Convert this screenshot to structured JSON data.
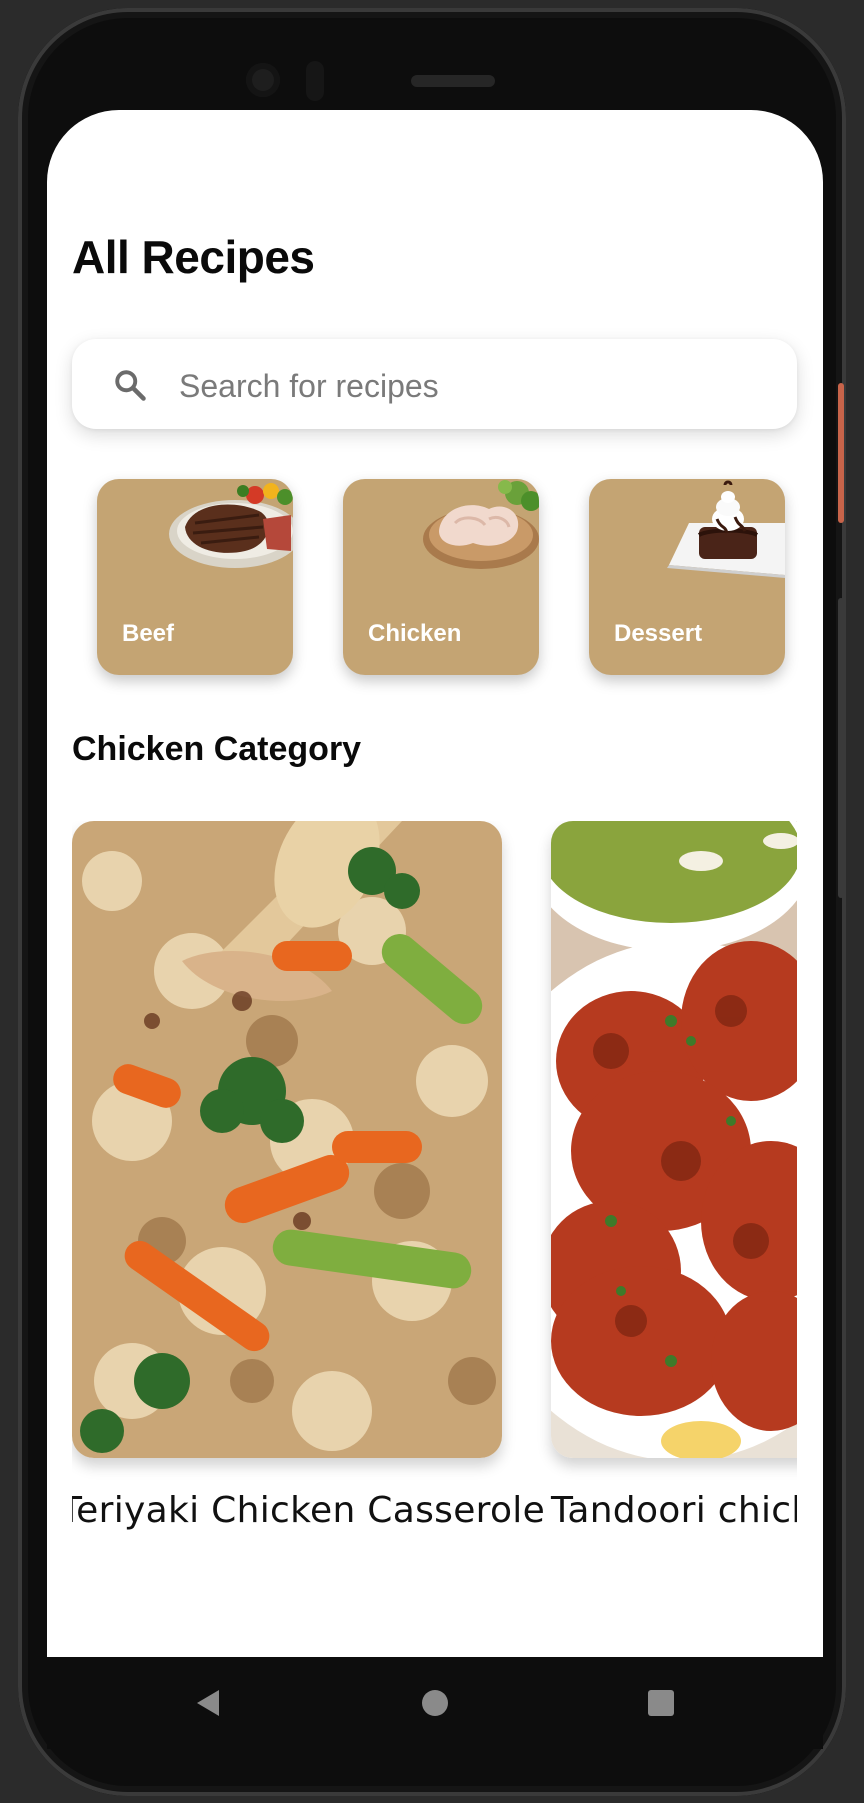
{
  "header": {
    "title": "All Recipes"
  },
  "search": {
    "placeholder": "Search for recipes",
    "value": ""
  },
  "categories": [
    {
      "label": "Beef",
      "icon": "beef-steak-image"
    },
    {
      "label": "Chicken",
      "icon": "raw-chicken-image"
    },
    {
      "label": "Dessert",
      "icon": "chocolate-dessert-image"
    }
  ],
  "section": {
    "title": "Chicken Category"
  },
  "recipes": [
    {
      "name": "Teriyaki Chicken Casserole",
      "image": "teriyaki-casserole-image"
    },
    {
      "name": "Tandoori chicken",
      "image": "tandoori-chicken-image"
    }
  ],
  "colors": {
    "category_card": "#c4a473",
    "text_primary": "#0a0a0a",
    "background": "#ffffff"
  },
  "navigation": {
    "back_icon": "triangle-back-icon",
    "home_icon": "circle-home-icon",
    "recents_icon": "square-recents-icon"
  }
}
